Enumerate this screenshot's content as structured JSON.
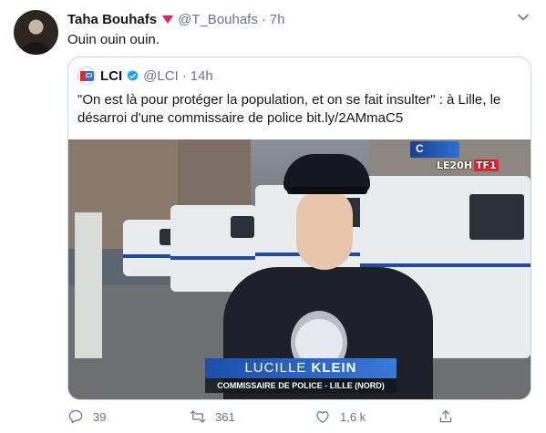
{
  "tweet": {
    "author_name": "Taha Bouhafs",
    "author_handle": "@T_Bouhafs",
    "separator": "·",
    "time": "7h",
    "text": "Ouin ouin ouin."
  },
  "quoted_tweet": {
    "author_name": "LCI",
    "author_handle": "@LCI",
    "separator": "·",
    "time": "14h",
    "text": "\"On est là pour protéger la population, et on se fait insulter\" : à Lille, le désarroi d'une commissaire de police bit.ly/2AMmaC5",
    "media": {
      "broadcast_logo": "LE20H",
      "broadcast_channel": "TF1",
      "lower_third_first": "LUCILLE",
      "lower_third_last": "KLEIN",
      "lower_third_role": "COMMISSAIRE DE POLICE - LILLE (NORD)"
    }
  },
  "actions": {
    "replies": "39",
    "retweets": "361",
    "likes": "1,6 k"
  },
  "colors": {
    "secondary_text": "#657786",
    "verified": "#1da1f2",
    "border": "#ccd6dd",
    "badge": "#e0245e"
  }
}
